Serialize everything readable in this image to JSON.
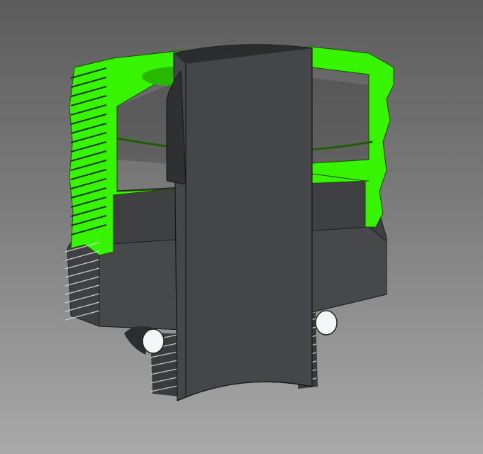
{
  "viewport": {
    "background_top": "#5c5c5c",
    "background_bottom": "#a9a9a9"
  },
  "model": {
    "section_color": "#33ff00",
    "body_color": "#3d3e40",
    "body_dark": "#2a2b2d",
    "pin_color": "#f4f6f8"
  }
}
